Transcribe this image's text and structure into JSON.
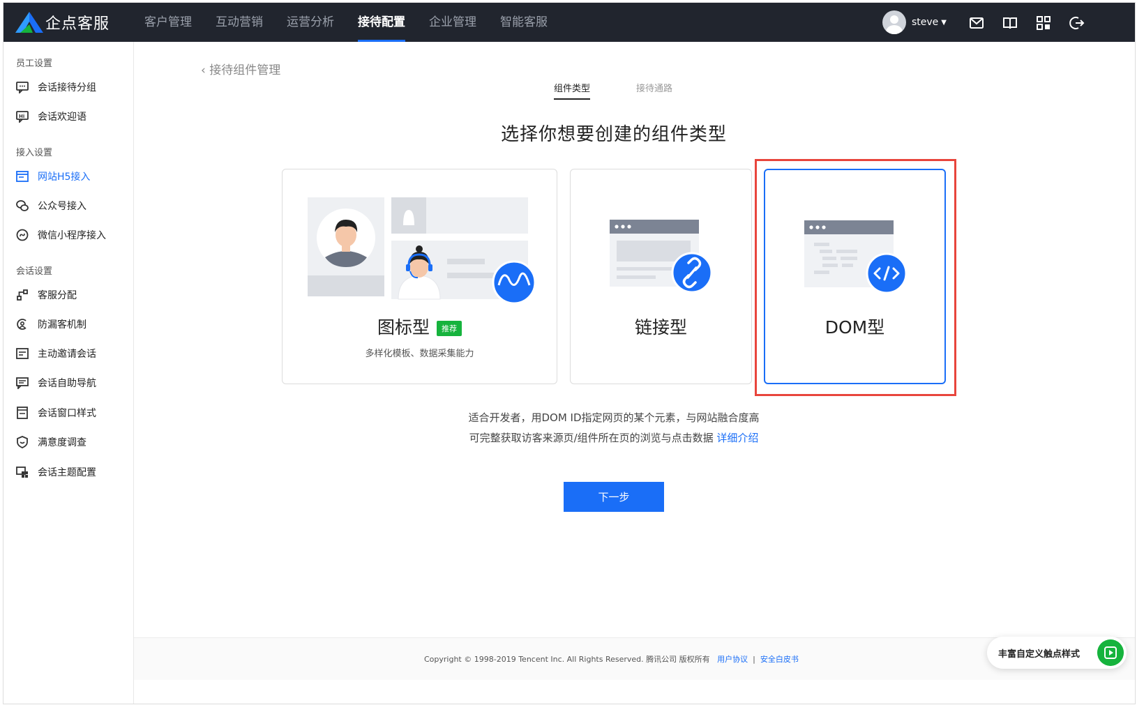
{
  "app": {
    "name": "企点客服"
  },
  "nav": {
    "items": [
      {
        "label": "客户管理"
      },
      {
        "label": "互动营销"
      },
      {
        "label": "运营分析"
      },
      {
        "label": "接待配置"
      },
      {
        "label": "企业管理"
      },
      {
        "label": "智能客服"
      }
    ],
    "active_index": 3
  },
  "user": {
    "name": "steve"
  },
  "header_icons": [
    "mail-icon",
    "book-icon",
    "grid-icon",
    "logout-icon"
  ],
  "sidebar": {
    "sections": [
      {
        "title": "员工设置",
        "items": [
          {
            "label": "会话接待分组",
            "icon": "chat-group-icon"
          },
          {
            "label": "会话欢迎语",
            "icon": "hi-message-icon"
          }
        ]
      },
      {
        "title": "接入设置",
        "items": [
          {
            "label": "网站H5接入",
            "icon": "web-icon",
            "active": true
          },
          {
            "label": "公众号接入",
            "icon": "wechat-icon"
          },
          {
            "label": "微信小程序接入",
            "icon": "miniprogram-icon"
          }
        ]
      },
      {
        "title": "会话设置",
        "items": [
          {
            "label": "客服分配",
            "icon": "distribute-icon"
          },
          {
            "label": "防漏客机制",
            "icon": "anti-loss-icon"
          },
          {
            "label": "主动邀请会话",
            "icon": "invite-icon"
          },
          {
            "label": "会话自助导航",
            "icon": "navigation-icon"
          },
          {
            "label": "会话窗口样式",
            "icon": "window-style-icon"
          },
          {
            "label": "满意度调查",
            "icon": "satisfaction-icon"
          },
          {
            "label": "会话主题配置",
            "icon": "theme-icon"
          }
        ]
      }
    ]
  },
  "main": {
    "back_label": "接待组件管理",
    "tabs": [
      {
        "label": "组件类型"
      },
      {
        "label": "接待通路"
      }
    ],
    "active_tab": 0,
    "heading": "选择你想要创建的组件类型",
    "cards": [
      {
        "title": "图标型",
        "badge": "推荐",
        "subtitle": "多样化模板、数据采集能力"
      },
      {
        "title": "链接型"
      },
      {
        "title": "DOM型",
        "selected": true
      }
    ],
    "description_line1": "适合开发者，用DOM ID指定网页的某个元素，与网站融合度高",
    "description_line2": "可完整获取访客来源页/组件所在页的浏览与点击数据",
    "description_link": "详细介绍",
    "next_button": "下一步"
  },
  "footer": {
    "copyright": "Copyright © 1998-2019 Tencent Inc. All Rights Reserved. 腾讯公司 版权所有",
    "link1": "用户协议",
    "separator": "|",
    "link2": "安全白皮书"
  },
  "floating_button": {
    "label": "丰富自定义触点样式"
  },
  "colors": {
    "accent": "#1a6ef7",
    "topbar": "#21252e",
    "highlight": "#e8453c",
    "badge": "#16b33d"
  }
}
